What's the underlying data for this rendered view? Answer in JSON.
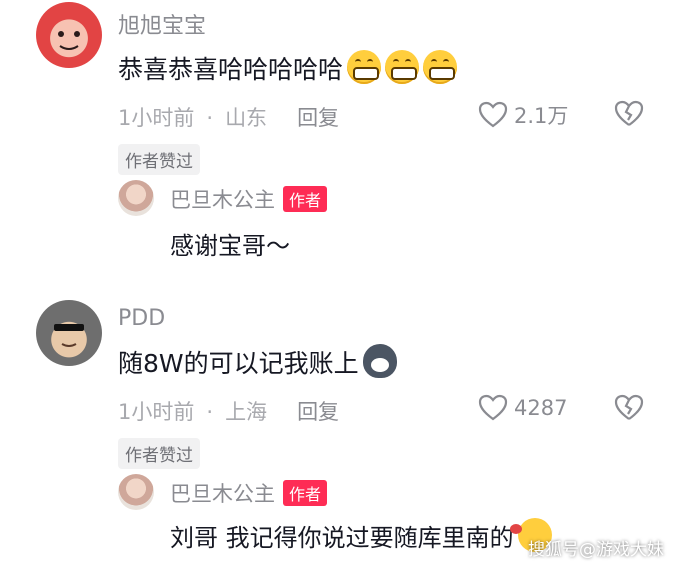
{
  "comments": [
    {
      "user": "旭旭宝宝",
      "text": "恭喜恭喜哈哈哈哈哈",
      "emoji": [
        "grin",
        "grin",
        "grin"
      ],
      "time": "1小时前",
      "location": "山东",
      "reply_label": "回复",
      "likes": "2.1万",
      "badge": "作者赞过",
      "reply": {
        "user": "巴旦木公主",
        "tag": "作者",
        "text": "感谢宝哥～"
      }
    },
    {
      "user": "PDD",
      "text": "随8W的可以记我账上",
      "emoji": [
        "wolf"
      ],
      "time": "1小时前",
      "location": "上海",
      "reply_label": "回复",
      "likes": "4287",
      "badge": "作者赞过",
      "reply": {
        "user": "巴旦木公主",
        "tag": "作者",
        "text": "刘哥 我记得你说过要随库里南的",
        "emoji": "wink"
      }
    }
  ],
  "watermark": "搜狐号@游戏大妹",
  "colors": {
    "author_tag": "#fe2c55",
    "meta": "#a8a9ae",
    "text": "#161823"
  }
}
